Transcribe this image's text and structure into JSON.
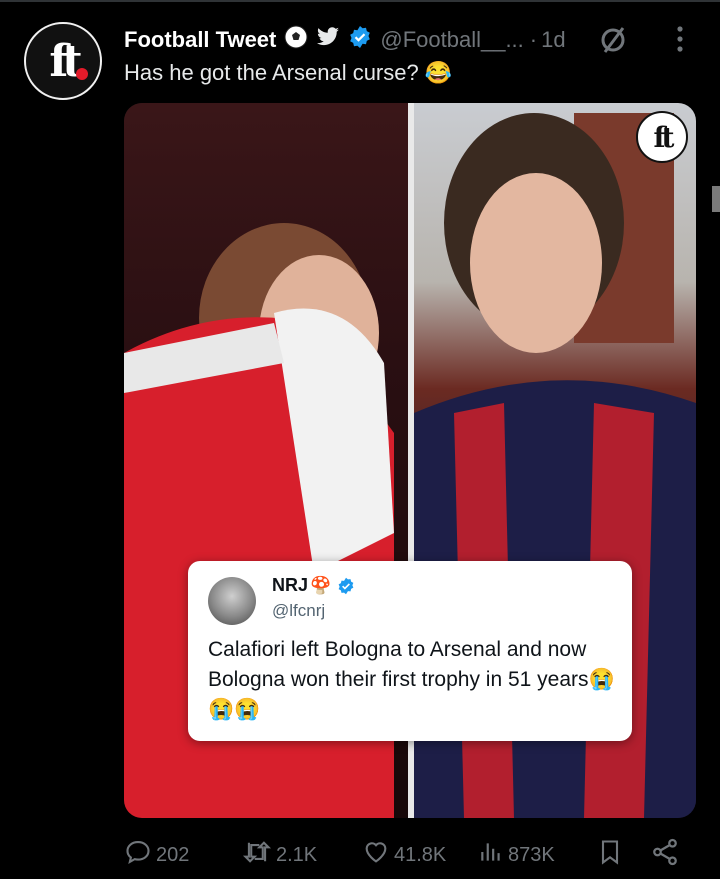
{
  "author": {
    "display_name": "Football Tweet",
    "handle": "@Football__...",
    "separator": "·",
    "time": "1d",
    "avatar_text": "ft"
  },
  "tweet": {
    "text": "Has he got the Arsenal curse? 😂"
  },
  "media": {
    "watermark_text": "ft",
    "left_photo": "player-in-arsenal-kit",
    "right_photo": "player-in-bologna-kit",
    "quoted_card": {
      "name": "NRJ",
      "name_emoji": "🍄",
      "handle": "@lfcnrj",
      "text": "Calafiori left Bologna to Arsenal and now Bologna won their first trophy in 51 years😭😭😭"
    }
  },
  "actions": {
    "replies": "202",
    "retweets": "2.1K",
    "likes": "41.8K",
    "views": "873K"
  },
  "colors": {
    "background": "#000000",
    "text": "#e7e9ea",
    "muted": "#71767b",
    "verified": "#1d9bf0"
  },
  "icons": [
    "soccer-ball-icon",
    "bird-icon",
    "verified-icon",
    "grok-icon",
    "more-icon",
    "reply-icon",
    "retweet-icon",
    "like-icon",
    "views-icon",
    "bookmark-icon",
    "share-icon"
  ]
}
